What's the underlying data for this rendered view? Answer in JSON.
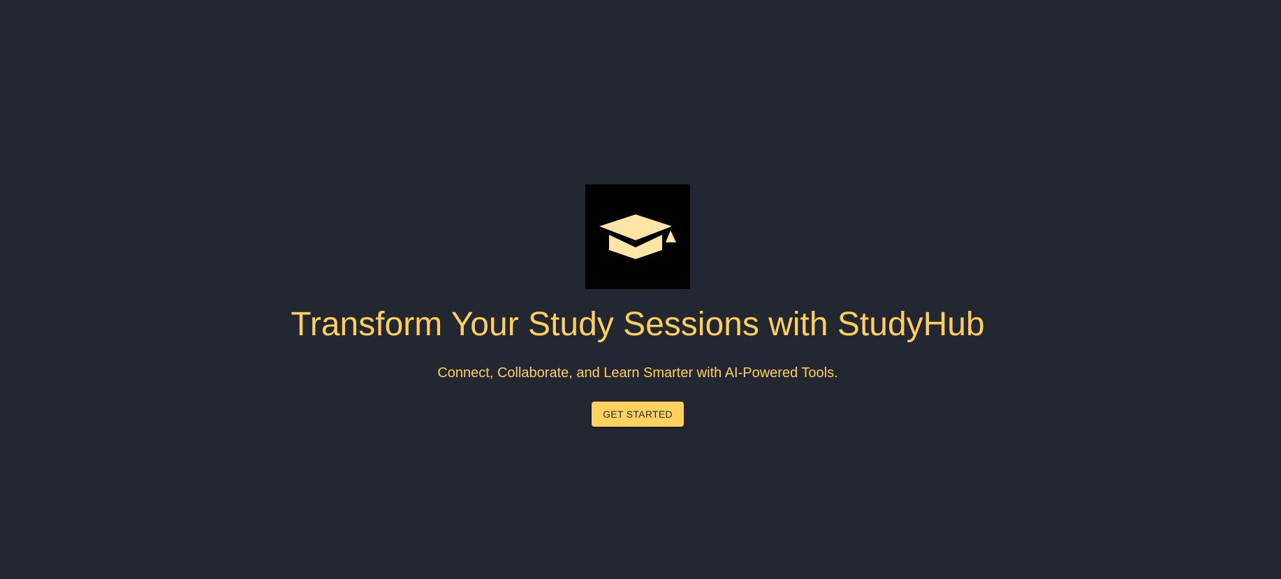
{
  "hero": {
    "logo_icon": "graduation-cap-icon",
    "headline": "Transform Your Study Sessions with StudyHub",
    "subheadline": "Connect, Collaborate, and Learn Smarter with AI-Powered Tools.",
    "cta_label": "GET STARTED"
  },
  "colors": {
    "background": "#222731",
    "accent": "#ffcf5c",
    "logo_background": "#000000",
    "logo_icon": "#ffe6a6",
    "button_background": "#ffd25f",
    "button_text": "#2a2a2a"
  }
}
